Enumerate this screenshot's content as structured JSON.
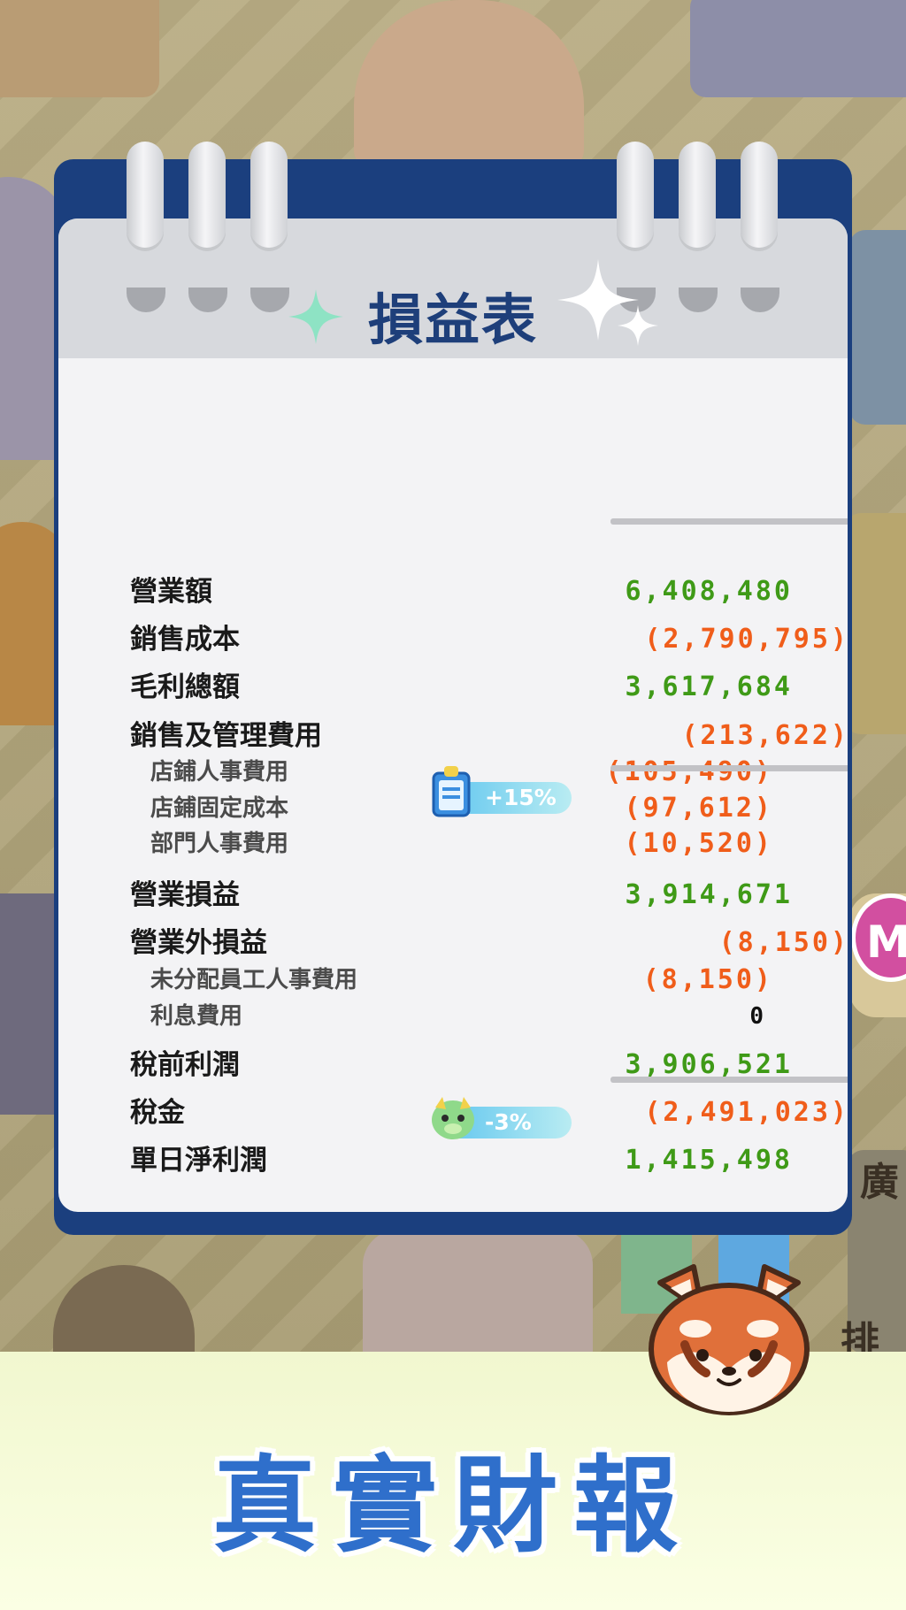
{
  "statement": {
    "title": "損益表",
    "rows": [
      {
        "label": "營業額",
        "value": "6,408,480",
        "level": "main",
        "sign": "pos"
      },
      {
        "label": "銷售成本",
        "value": "(2,790,795)",
        "level": "main",
        "sign": "neg"
      },
      {
        "label": "毛利總額",
        "value": "3,617,684",
        "level": "main",
        "sign": "pos"
      },
      {
        "label": "銷售及管理費用",
        "value": "(213,622)",
        "level": "main",
        "sign": "neg"
      },
      {
        "label": "店鋪人事費用",
        "value": "(105,490)",
        "level": "sub",
        "sign": "neg"
      },
      {
        "label": "店鋪固定成本",
        "value": "(97,612)",
        "level": "sub",
        "sign": "neg"
      },
      {
        "label": "部門人事費用",
        "value": "(10,520)",
        "level": "sub",
        "sign": "neg"
      },
      {
        "label": "營業損益",
        "value": "3,914,671",
        "level": "main",
        "sign": "pos"
      },
      {
        "label": "營業外損益",
        "value": "(8,150)",
        "level": "main",
        "sign": "neg"
      },
      {
        "label": "未分配員工人事費用",
        "value": "(8,150)",
        "level": "sub",
        "sign": "neg"
      },
      {
        "label": "利息費用",
        "value": "0",
        "level": "sub",
        "sign": "zero"
      },
      {
        "label": "稅前利潤",
        "value": "3,906,521",
        "level": "main",
        "sign": "pos"
      },
      {
        "label": "稅金",
        "value": "(2,491,023)",
        "level": "main",
        "sign": "neg"
      },
      {
        "label": "單日淨利潤",
        "value": "1,415,498",
        "level": "main",
        "sign": "pos"
      }
    ],
    "badges": {
      "operating_bonus": "+15%",
      "tax_bonus": "-3%"
    }
  },
  "background": {
    "side_label_1": "廣",
    "side_label_2": "排行",
    "side_badge": "M"
  },
  "banner": {
    "text": "真實財報"
  },
  "colors": {
    "positive": "#3f9a17",
    "negative": "#f05d1a",
    "title": "#1e3f7a",
    "banner_text": "#2f6fcb",
    "panel_frame": "#1b3f7e"
  }
}
